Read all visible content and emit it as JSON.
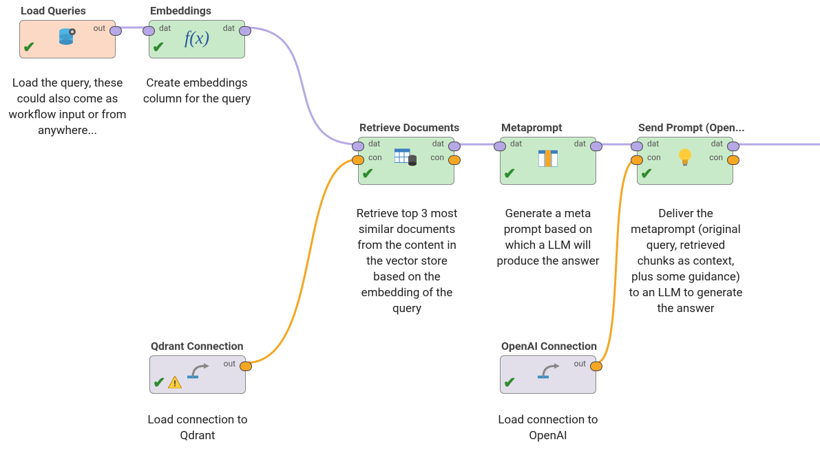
{
  "ports": {
    "dat": "dat",
    "con": "con",
    "out": "out"
  },
  "colors": {
    "wire_dat": "#b6a8e6",
    "wire_con": "#f5a623",
    "node_orange": "#fbd9c5",
    "node_green": "#c9eac9",
    "node_grey": "#e2dfea"
  },
  "nodes": {
    "load_queries": {
      "title": "Load Queries",
      "desc": "Load the query, these could also come as workflow input or from anywhere..."
    },
    "embeddings": {
      "title": "Embeddings",
      "desc": "Create embeddings column for the query"
    },
    "retrieve_docs": {
      "title": "Retrieve Documents",
      "desc": "Retrieve top 3 most similar documents from the content in the vector store based on the embedding of the query"
    },
    "qdrant_conn": {
      "title": "Qdrant Connection",
      "desc": "Load connection to Qdrant"
    },
    "metaprompt": {
      "title": "Metaprompt",
      "desc": "Generate a meta prompt based on which a LLM will produce the answer"
    },
    "openai_conn": {
      "title": "OpenAI Connection",
      "desc": "Load connection to OpenAI"
    },
    "send_prompt": {
      "title": "Send Prompt (Open...",
      "desc": "Deliver the metaprompt (original query, retrieved chunks as context, plus some guidance) to an LLM to generate the answer"
    }
  }
}
